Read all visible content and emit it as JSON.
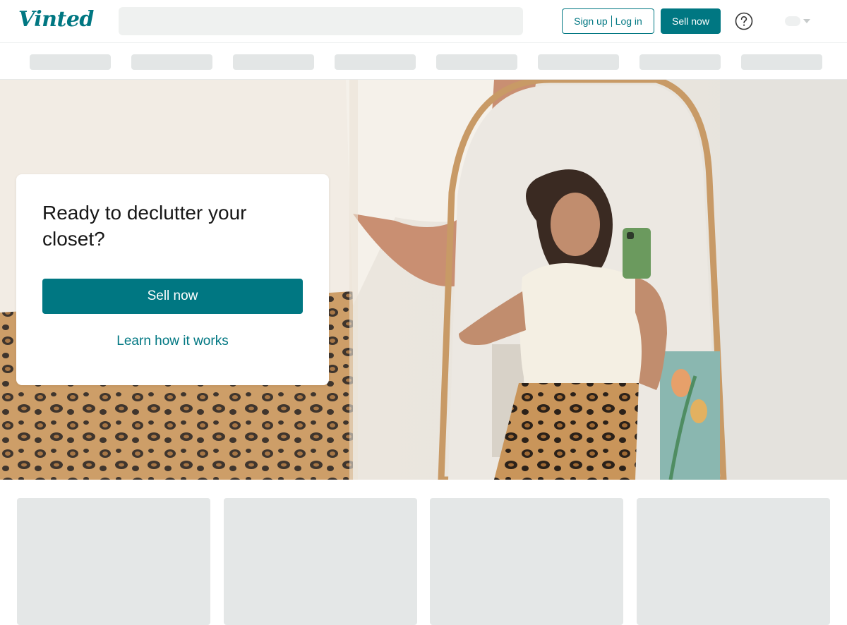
{
  "header": {
    "logo": "Vinted",
    "auth": {
      "signup_label": "Sign up",
      "login_label": "Log in"
    },
    "sell_label": "Sell now",
    "help_icon": "question-circle-icon",
    "language_icon": "chevron-down-icon"
  },
  "hero": {
    "title": "Ready to declutter your closet?",
    "sell_label": "Sell now",
    "learn_label": "Learn how it works"
  },
  "colors": {
    "brand": "#007782",
    "placeholder": "#e4e7e7",
    "search_background": "#eff1f0"
  }
}
